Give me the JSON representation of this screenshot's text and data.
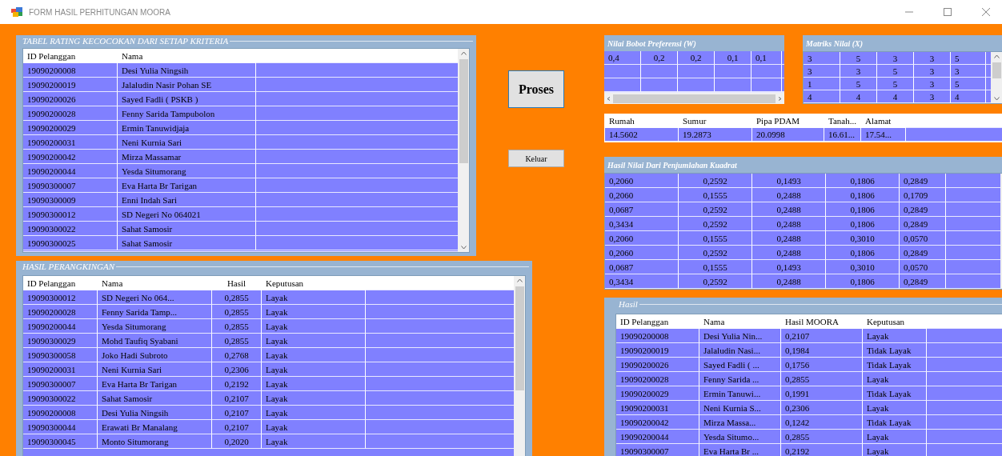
{
  "window": {
    "title": "FORM HASIL PERHITUNGAN MOORA"
  },
  "rating_group": {
    "title": "TABEL RATING KECOCOKAN DARI SETIAP KRITERIA",
    "columns": [
      "ID Pelanggan",
      "Nama"
    ],
    "rows": [
      [
        "19090200008",
        "Desi Yulia Ningsih"
      ],
      [
        "19090200019",
        "Jalaludin Nasir Pohan SE"
      ],
      [
        "19090200026",
        "Sayed Fadli ( PSKB )"
      ],
      [
        "19090200028",
        "Fenny Sarida Tampubolon"
      ],
      [
        "19090200029",
        "Ermin Tanuwidjaja"
      ],
      [
        "19090200031",
        "Neni Kurnia Sari"
      ],
      [
        "19090200042",
        "Mirza Massamar"
      ],
      [
        "19090200044",
        "Yesda Situmorang"
      ],
      [
        "19090300007",
        "Eva Harta Br Tarigan"
      ],
      [
        "19090300009",
        "Enni Indah Sari"
      ],
      [
        "19090300012",
        "SD Negeri No 064021"
      ],
      [
        "19090300022",
        "Sahat Samosir"
      ],
      [
        "19090300025",
        "Sahat Samosir"
      ]
    ]
  },
  "ranking_group": {
    "title": "HASIL PERANGKINGAN",
    "columns": [
      "ID Pelanggan",
      "Nama",
      "Hasil",
      "Keputusan"
    ],
    "rows": [
      [
        "19090300012",
        "SD Negeri No 064...",
        "0,2855",
        "Layak"
      ],
      [
        "19090200028",
        "Fenny Sarida Tamp...",
        "0,2855",
        "Layak"
      ],
      [
        "19090200044",
        "Yesda Situmorang",
        "0,2855",
        "Layak"
      ],
      [
        "19090300029",
        "Mohd Taufiq Syabani",
        "0,2855",
        "Layak"
      ],
      [
        "19090300058",
        "Joko Hadi Subroto",
        "0,2768",
        "Layak"
      ],
      [
        "19090200031",
        "Neni Kurnia Sari",
        "0,2306",
        "Layak"
      ],
      [
        "19090300007",
        "Eva Harta Br Tarigan",
        "0,2192",
        "Layak"
      ],
      [
        "19090300022",
        "Sahat Samosir",
        "0,2107",
        "Layak"
      ],
      [
        "19090200008",
        "Desi Yulia Ningsih",
        "0,2107",
        "Layak"
      ],
      [
        "19090300044",
        "Erawati Br Manalang",
        "0,2107",
        "Layak"
      ],
      [
        "19090300045",
        "Monto Situmorang",
        "0,2020",
        "Layak"
      ]
    ]
  },
  "buttons": [
    {
      "label": "Proses",
      "kind": "large"
    },
    {
      "label": "Keluar",
      "kind": "small"
    }
  ],
  "weights_group": {
    "title": "Nilai Bobot Preferensi (W)",
    "rows": [
      [
        "0,4",
        "0,2",
        "0,2",
        "0,1",
        "0,1"
      ]
    ]
  },
  "matrix_group": {
    "title": "Matriks Nilai (X)",
    "rows": [
      [
        "3",
        "5",
        "3",
        "3",
        "5"
      ],
      [
        "3",
        "3",
        "5",
        "3",
        "3"
      ],
      [
        "1",
        "5",
        "5",
        "3",
        "5"
      ],
      [
        "4",
        "4",
        "4",
        "3",
        "4"
      ]
    ]
  },
  "totals_table": {
    "columns": [
      "Rumah",
      "Sumur",
      "Pipa PDAM",
      "Tanah...",
      "Alamat"
    ],
    "rows": [
      [
        "14.5602",
        "19.2873",
        "20.0998",
        "16.61...",
        "17.54..."
      ]
    ]
  },
  "squares_group": {
    "title": "Hasil Nilai Dari Penjumlahan Kuadrat",
    "rows": [
      [
        "0,2060",
        "0,2592",
        "0,1493",
        "0,1806",
        "0,2849"
      ],
      [
        "0,2060",
        "0,1555",
        "0,2488",
        "0,1806",
        "0,1709"
      ],
      [
        "0,0687",
        "0,2592",
        "0,2488",
        "0,1806",
        "0,2849"
      ],
      [
        "0,3434",
        "0,2592",
        "0,2488",
        "0,1806",
        "0,2849"
      ],
      [
        "0,2060",
        "0,1555",
        "0,2488",
        "0,3010",
        "0,0570"
      ],
      [
        "0,2060",
        "0,2592",
        "0,2488",
        "0,1806",
        "0,2849"
      ],
      [
        "0,0687",
        "0,1555",
        "0,1493",
        "0,3010",
        "0,0570"
      ],
      [
        "0,3434",
        "0,2592",
        "0,2488",
        "0,1806",
        "0,2849"
      ]
    ]
  },
  "result_group": {
    "title": "Hasil",
    "columns": [
      "ID Pelanggan",
      "Nama",
      "Hasil MOORA",
      "Keputusan"
    ],
    "rows": [
      [
        "19090200008",
        "Desi Yulia Nin...",
        "0,2107",
        "Layak"
      ],
      [
        "19090200019",
        "Jalaludin Nasi...",
        "0,1984",
        "Tidak Layak"
      ],
      [
        "19090200026",
        "Sayed Fadli ( ...",
        "0,1756",
        "Tidak Layak"
      ],
      [
        "19090200028",
        "Fenny Sarida ...",
        "0,2855",
        "Layak"
      ],
      [
        "19090200029",
        "Ermin Tanuwi...",
        "0,1991",
        "Tidak Layak"
      ],
      [
        "19090200031",
        "Neni Kurnia S...",
        "0,2306",
        "Layak"
      ],
      [
        "19090200042",
        "Mirza Massa...",
        "0,1242",
        "Tidak Layak"
      ],
      [
        "19090200044",
        "Yesda Situmo...",
        "0,2855",
        "Layak"
      ],
      [
        "19090300007",
        "Eva Harta Br ...",
        "0,2192",
        "Layak"
      ]
    ]
  }
}
